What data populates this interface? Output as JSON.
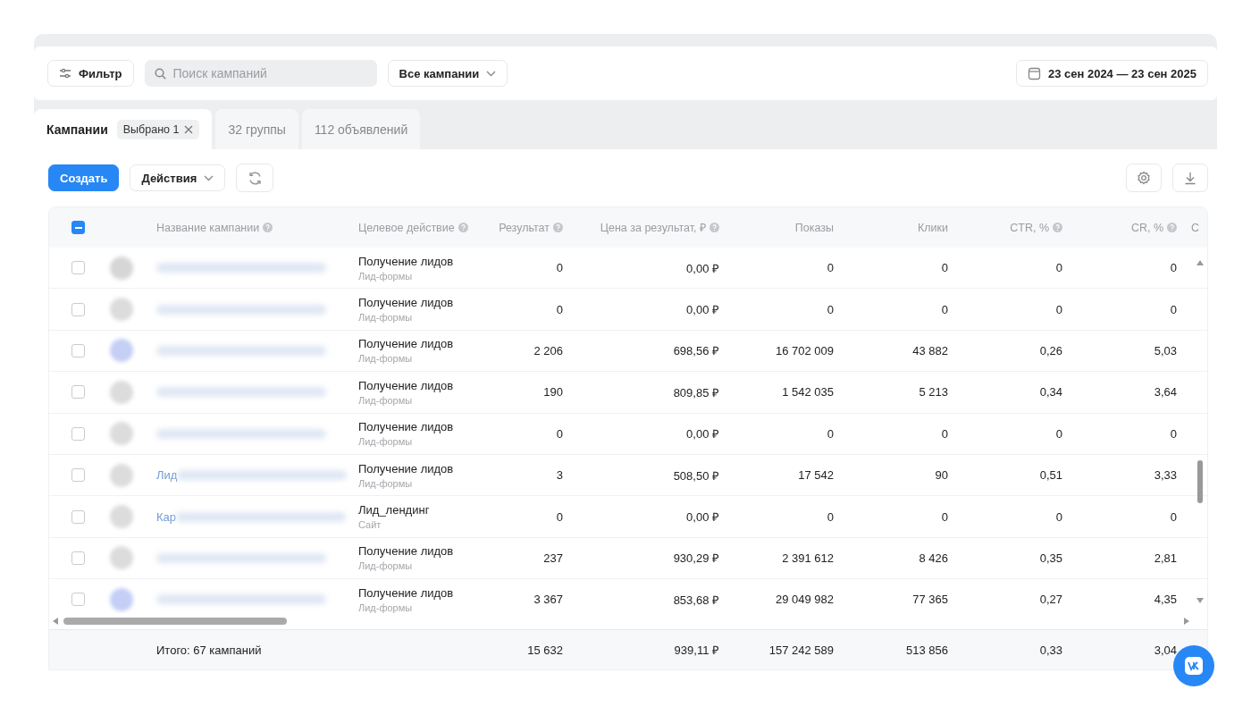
{
  "toolbar": {
    "filter_button": "Фильтр",
    "search": {
      "placeholder": "Поиск кампаний"
    },
    "scope_dropdown": "Все кампании",
    "date_range": "23 сен 2024 — 23 сен 2025"
  },
  "tabs": [
    {
      "label": "Кампании",
      "selected": true,
      "chip": "Выбрано 1"
    },
    {
      "label": "32 группы",
      "selected": false
    },
    {
      "label": "112 объявлений",
      "selected": false
    }
  ],
  "actions": {
    "create_button": "Создать",
    "actions_dropdown": "Действия"
  },
  "table": {
    "header_checkbox": {
      "checked": true
    },
    "columns": [
      {
        "label": "Название кампании",
        "help": true
      },
      {
        "label": "Целевое действие",
        "help": true
      },
      {
        "label": "Результат",
        "help": true
      },
      {
        "label": "Цена за результат, ₽",
        "help": true
      },
      {
        "label": "Показы",
        "help": false
      },
      {
        "label": "Клики",
        "help": false
      },
      {
        "label": "CTR, %",
        "help": true
      },
      {
        "label": "CR, %",
        "help": true
      },
      {
        "label": "С",
        "help": false
      }
    ],
    "rows": [
      {
        "checked": false,
        "color": "#d6d6d6",
        "action_type": "Лид-формы",
        "cells": [
          "",
          "Получение лидов",
          "0",
          "0,00 ₽",
          "0",
          "0",
          "0",
          "0"
        ]
      },
      {
        "checked": false,
        "color": "#dcdcdc",
        "action_type": "Лид-формы",
        "cells": [
          "",
          "Получение лидов",
          "0",
          "0,00 ₽",
          "0",
          "0",
          "0",
          "0"
        ]
      },
      {
        "checked": false,
        "color": "#c5cff5",
        "action_type": "Лид-формы",
        "cells": [
          "",
          "Получение лидов",
          "2 206",
          "698,56 ₽",
          "16 702 009",
          "43 882",
          "0,26",
          "5,03"
        ]
      },
      {
        "checked": false,
        "color": "#dcdcdc",
        "action_type": "Лид-формы",
        "cells": [
          "",
          "Получение лидов",
          "190",
          "809,85 ₽",
          "1 542 035",
          "5 213",
          "0,34",
          "3,64"
        ]
      },
      {
        "checked": false,
        "color": "#dcdcdc",
        "action_type": "Лид-формы",
        "cells": [
          "",
          "Получение лидов",
          "0",
          "0,00 ₽",
          "0",
          "0",
          "0",
          "0"
        ]
      },
      {
        "checked": false,
        "color": "#dcdcdc",
        "action_type": "Лид-формы",
        "cells": [
          "Лид",
          "Получение лидов",
          "3",
          "508,50 ₽",
          "17 542",
          "90",
          "0,51",
          "3,33"
        ]
      },
      {
        "checked": false,
        "color": "#dcdcdc",
        "action_type": "Сайт",
        "cells": [
          "Кар",
          "Лид_лендинг",
          "0",
          "0,00 ₽",
          "0",
          "0",
          "0",
          "0"
        ]
      },
      {
        "checked": false,
        "color": "#dcdcdc",
        "action_type": "Лид-формы",
        "cells": [
          "",
          "Получение лидов",
          "237",
          "930,29 ₽",
          "2 391 612",
          "8 426",
          "0,35",
          "2,81"
        ]
      },
      {
        "checked": false,
        "color": "#c5cff5",
        "action_type": "Лид-формы",
        "cells": [
          "",
          "Получение лидов",
          "3 367",
          "853,68 ₽",
          "29 049 982",
          "77 365",
          "0,27",
          "4,35"
        ]
      }
    ],
    "total": {
      "cells": [
        "Итого: 67 кампаний",
        "",
        "15 632",
        "939,11 ₽",
        "157 242 589",
        "513 856",
        "0,33",
        "3,04"
      ]
    }
  }
}
